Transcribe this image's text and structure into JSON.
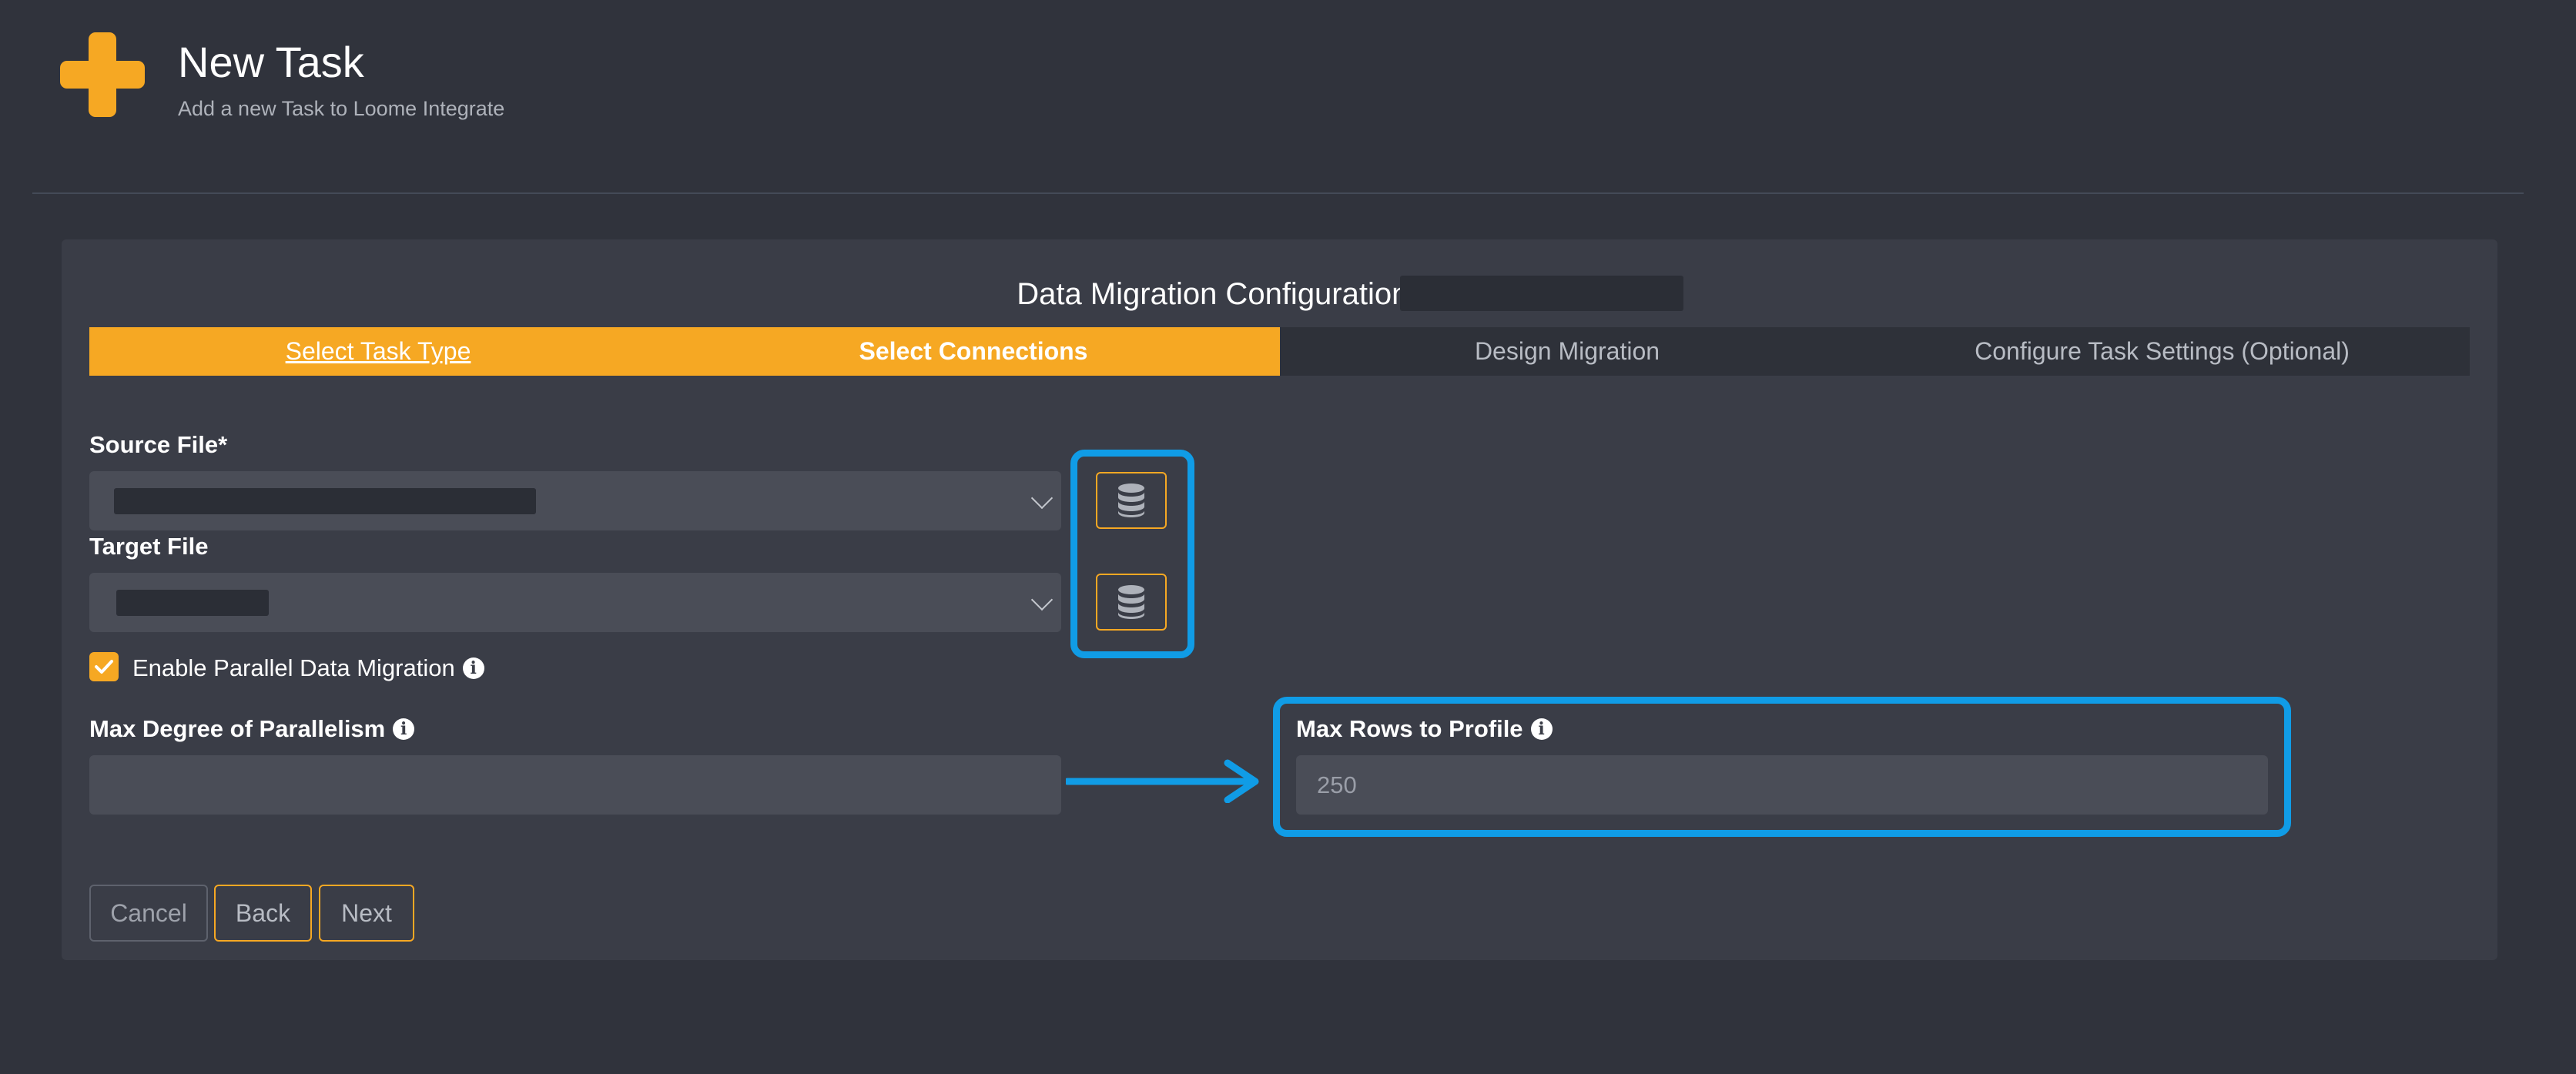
{
  "header": {
    "title": "New Task",
    "subtitle": "Add a new Task to Loome Integrate",
    "logo_icon": "plus-icon",
    "accent_color": "#f6a823"
  },
  "panel": {
    "title": "Data Migration Configuration for Task"
  },
  "steps": [
    {
      "label": "Select Task Type",
      "state": "completed-link"
    },
    {
      "label": "Select Connections",
      "state": "current"
    },
    {
      "label": "Design Migration",
      "state": "upcoming"
    },
    {
      "label": "Configure Task Settings (Optional)",
      "state": "upcoming"
    }
  ],
  "form": {
    "source_file": {
      "label": "Source File*",
      "icon": "chevron-down-icon"
    },
    "target_file": {
      "label": "Target File",
      "icon": "chevron-down-icon"
    },
    "connection_button_icon": "database-icon",
    "parallel": {
      "label": "Enable Parallel Data Migration",
      "checked": true
    },
    "max_degree": {
      "label": "Max Degree of Parallelism",
      "value": ""
    },
    "max_rows": {
      "label": "Max Rows to Profile",
      "value": "250"
    },
    "info_icon": "info-icon"
  },
  "annotations": {
    "highlight_color": "#109ce6",
    "arrow_icon": "arrow-right-icon"
  },
  "buttons": {
    "cancel": "Cancel",
    "back": "Back",
    "next": "Next"
  }
}
